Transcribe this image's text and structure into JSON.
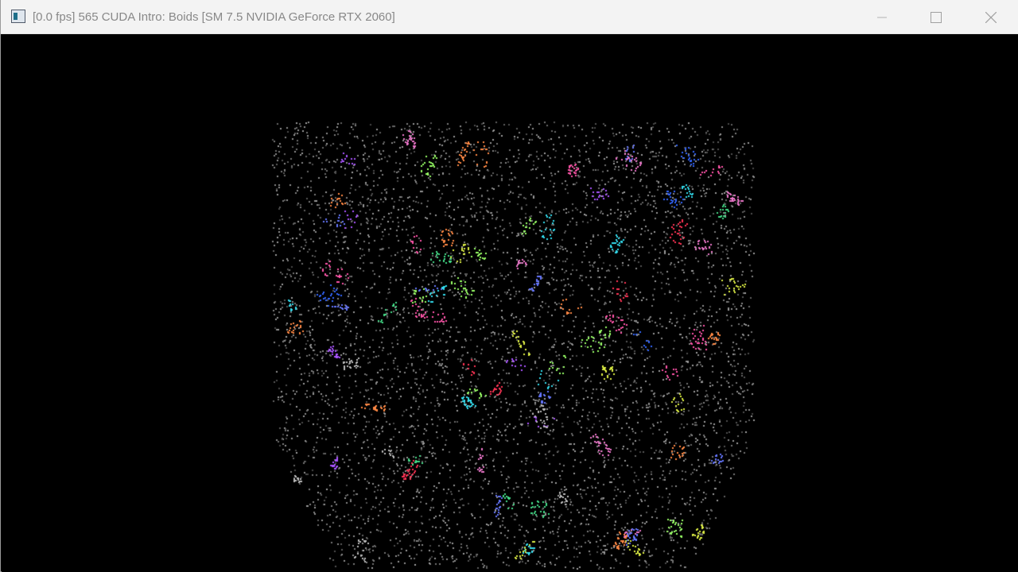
{
  "window": {
    "title": "[0.0 fps] 565 CUDA Intro: Boids [SM 7.5 NVIDIA GeForce RTX 2060]",
    "icon": "app-window-icon",
    "controls": {
      "minimize_icon": "minimize-icon",
      "maximize_icon": "maximize-icon",
      "close_icon": "close-icon"
    }
  },
  "viewport": {
    "background": "#000000",
    "particle_colors": [
      "#ff3355",
      "#33ddee",
      "#6677ff",
      "#aa55ff",
      "#44dd88",
      "#ddee44",
      "#ff8844",
      "#ee77cc",
      "#bbbbbb",
      "#3366ff",
      "#ff55aa",
      "#99ff66"
    ]
  }
}
